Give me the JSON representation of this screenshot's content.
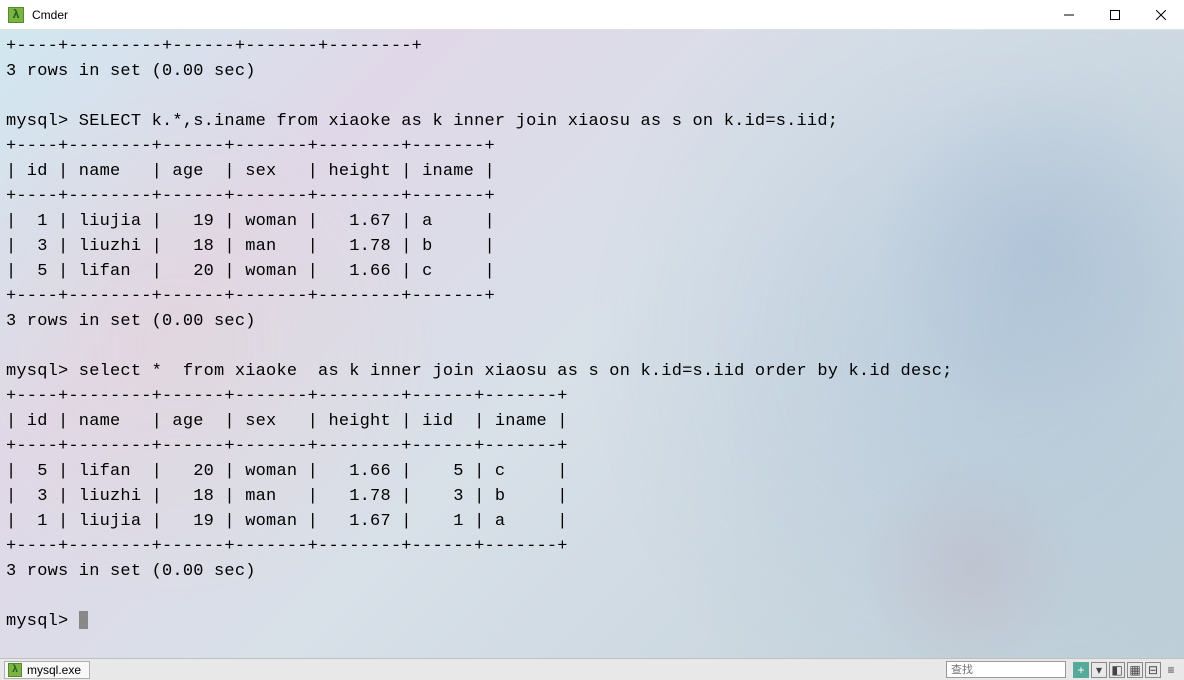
{
  "window": {
    "title": "Cmder"
  },
  "terminal": {
    "output": "+----+---------+------+-------+--------+\n3 rows in set (0.00 sec)\n\nmysql> SELECT k.*,s.iname from xiaoke as k inner join xiaosu as s on k.id=s.iid;\n+----+--------+------+-------+--------+-------+\n| id | name   | age  | sex   | height | iname |\n+----+--------+------+-------+--------+-------+\n|  1 | liujia |   19 | woman |   1.67 | a     |\n|  3 | liuzhi |   18 | man   |   1.78 | b     |\n|  5 | lifan  |   20 | woman |   1.66 | c     |\n+----+--------+------+-------+--------+-------+\n3 rows in set (0.00 sec)\n\nmysql> select *  from xiaoke  as k inner join xiaosu as s on k.id=s.iid order by k.id desc;\n+----+--------+------+-------+--------+------+-------+\n| id | name   | age  | sex   | height | iid  | iname |\n+----+--------+------+-------+--------+------+-------+\n|  5 | lifan  |   20 | woman |   1.66 |    5 | c     |\n|  3 | liuzhi |   18 | man   |   1.78 |    3 | b     |\n|  1 | liujia |   19 | woman |   1.67 |    1 | a     |\n+----+--------+------+-------+--------+------+-------+\n3 rows in set (0.00 sec)\n\nmysql> "
  },
  "statusbar": {
    "tab_label": "mysql.exe",
    "search_placeholder": "查找"
  }
}
